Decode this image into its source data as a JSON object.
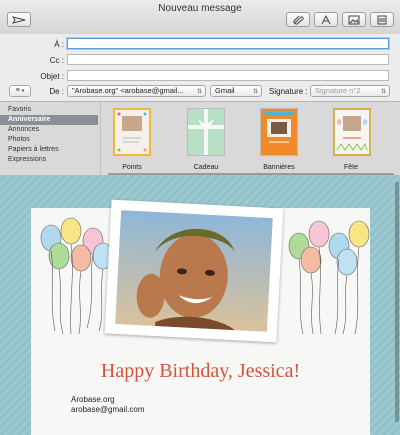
{
  "window": {
    "title": "Nouveau message"
  },
  "toolbar": {
    "send": "send-icon",
    "attach": "paperclip-icon",
    "format": "font-icon",
    "photo": "photo-browser-icon",
    "stationery": "stationery-icon"
  },
  "header": {
    "to_label": "À :",
    "cc_label": "Cc :",
    "subject_label": "Objet :",
    "from_label": "De :",
    "from_value": "\"Arobase.org\" <arobase@gmail...",
    "account_value": "Gmail",
    "signature_label": "Signature :",
    "signature_value": "Signature n°2",
    "menu_button": "≡"
  },
  "stationery": {
    "categories": [
      "Favoris",
      "Anniversaire",
      "Annonces",
      "Photos",
      "Papiers à lettres",
      "Expressions"
    ],
    "selected_category": "Anniversaire",
    "templates": [
      "Points",
      "Cadeau",
      "Bannières",
      "Fête"
    ]
  },
  "message": {
    "greeting": "Happy Birthday, Jessica!",
    "sig_line1": "Arobase.org",
    "sig_line2": "arobase@gmail.com"
  },
  "colors": {
    "accent": "#5b9be0",
    "greeting": "#d2533a",
    "background": "#9ccad0"
  }
}
